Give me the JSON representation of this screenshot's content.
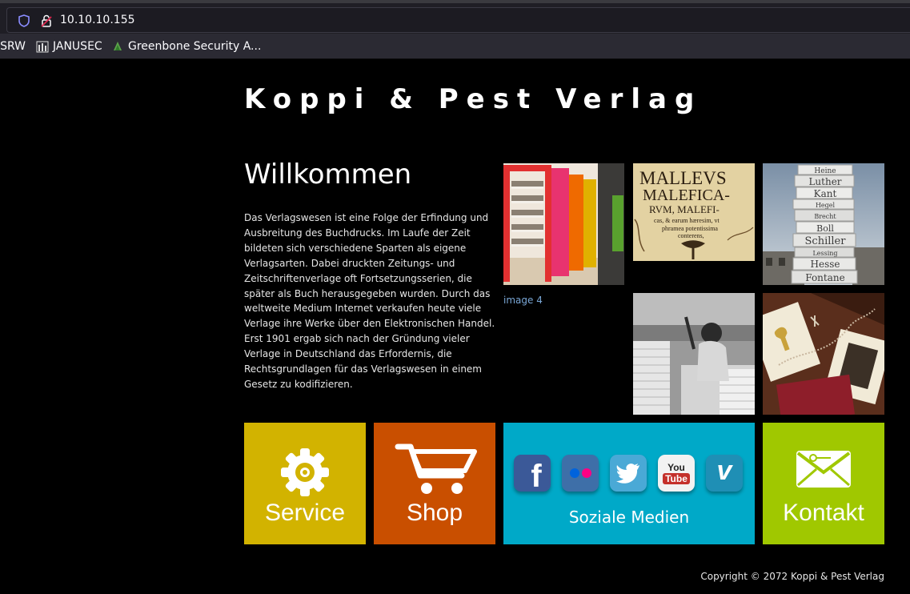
{
  "browser": {
    "url": "10.10.10.155",
    "bookmarks": [
      {
        "label": "ISRW",
        "icon": "bookmark-icon"
      },
      {
        "label": "JANUSEC",
        "icon": "janusec-icon"
      },
      {
        "label": "Greenbone Security A...",
        "icon": "greenbone-icon"
      }
    ]
  },
  "site": {
    "title": "Koppi & Pest Verlag",
    "heading": "Willkommen",
    "intro": "Das Verlagswesen ist eine Folge der Erfindung und Ausbreitung des Buchdrucks. Im Laufe der Zeit bildeten sich verschiedene Sparten als eigene Verlagsarten. Dabei druckten Zeitungs- und Zeitschriftenverlage oft Fortsetzungsserien, die später als Buch herausgegeben wurden. Durch das weltweite Medium Internet verkaufen heute viele Verlage ihre Werke über den Elektronischen Handel. Erst 1901 ergab sich nach der Gründung vieler Verlage in Deutschland das Erfordernis, die Rechtsgrundlagen für das Verlagswesen in einem Gesetz zu kodifizieren.",
    "image_caption": "image 4",
    "gallery": {
      "malleus_lines": [
        "MALLEVS",
        "MALEFICA-",
        "RVM, MALEFI-",
        "cas, & earum hæresim, vt",
        "phramea potentissima",
        "conterens,"
      ],
      "book_stack_names": [
        "Heine",
        "Luther",
        "Kant",
        "Hegel",
        "Brecht",
        "Boll",
        "Schiller",
        "Lessing",
        "Hesse",
        "Fontane"
      ]
    },
    "nav": {
      "service": "Service",
      "shop": "Shop",
      "social": "Soziale Medien",
      "contact": "Kontakt"
    },
    "social_icons": [
      {
        "name": "facebook-icon",
        "glyph": "f",
        "color": "#3b5998"
      },
      {
        "name": "flickr-icon",
        "glyph": "",
        "color": "#3e6fa8"
      },
      {
        "name": "twitter-icon",
        "glyph": "",
        "color": "#4aa9d6"
      },
      {
        "name": "youtube-icon",
        "glyph": "You Tube",
        "color": "#c4302b"
      },
      {
        "name": "vimeo-icon",
        "glyph": "v",
        "color": "#1f8fb5"
      }
    ],
    "colors": {
      "service": "#d2b300",
      "shop": "#c94f00",
      "social": "#00a9c8",
      "contact": "#a0c800"
    },
    "copyright": "Copyright © 2072 Koppi & Pest Verlag"
  }
}
